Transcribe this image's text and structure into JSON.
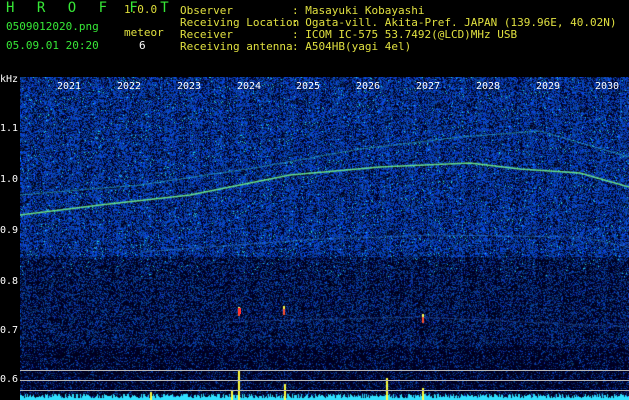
{
  "app": {
    "title": "H R O F F T",
    "version": "1.0.0",
    "filename": "0509012020.png",
    "datetime": "05.09.01 20:20",
    "meteor_label": "meteor",
    "meteor_count": "6"
  },
  "info": {
    "observer_label": "Observer",
    "observer_value": ": Masayuki Kobayashi",
    "location_label": "Receiving Location",
    "location_value": ": Ogata-vill. Akita-Pref. JAPAN (139.96E, 40.02N)",
    "receiver_label": "Receiver",
    "receiver_value": ": ICOM IC-575 53.7492(@LCD)MHz USB",
    "antenna_label": "Receiving antenna",
    "antenna_value": ": A504HB(yagi 4el)"
  },
  "axis": {
    "unit": "kHz",
    "ticks": [
      "1.1",
      "1.0",
      "0.9",
      "0.8",
      "0.7",
      "0.6"
    ],
    "years": [
      "2021",
      "2022",
      "2023",
      "2024",
      "2025",
      "2026",
      "2027",
      "2028",
      "2029",
      "2030"
    ]
  },
  "colors": {
    "background": "#000000",
    "title_green": "#37e837",
    "version_yellow": "#dede3a",
    "noise_blue": "#1e4cff",
    "trace_green": "#7cff7c",
    "spike_yellow": "#ffff40",
    "baseline_cyan": "#30e0ff"
  }
}
